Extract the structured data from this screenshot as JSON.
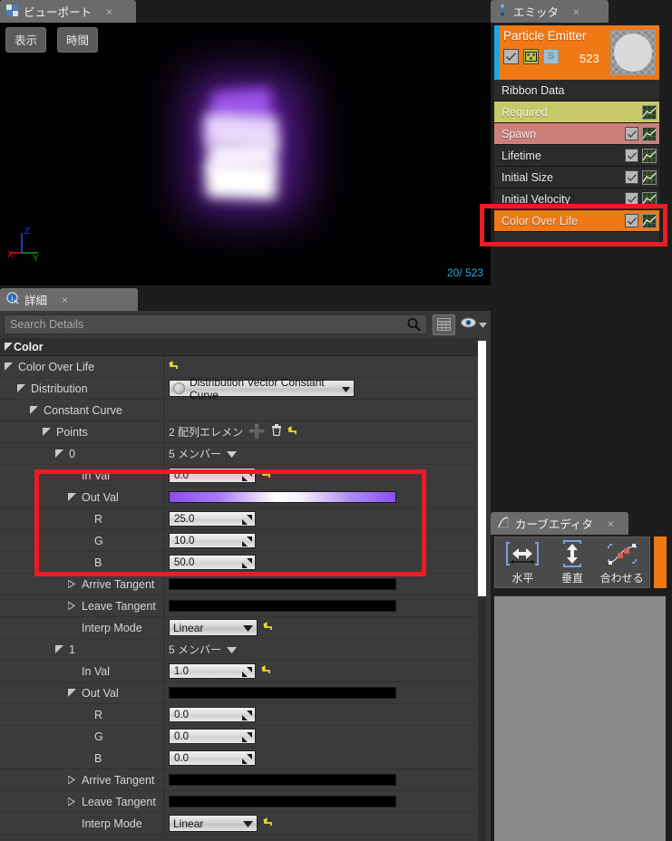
{
  "viewport": {
    "tab_title": "ビューポート",
    "tab_icon": "viewport-grid-icon",
    "close_icon": "×",
    "buttons": [
      {
        "label": "表示",
        "name": "view-menu-button"
      },
      {
        "label": "時間",
        "name": "time-menu-button"
      }
    ],
    "axis": {
      "x": "X",
      "y": "Y",
      "z": "Z"
    },
    "particle_count": "20/ 523"
  },
  "details": {
    "tab_title": "詳細",
    "tab_icon": "details-info-icon",
    "close_icon": "×",
    "search": {
      "placeholder": "Search Details",
      "value": ""
    },
    "category": "Color",
    "rows": [
      {
        "name": "color-over-life",
        "label": "Color Over Life",
        "indent": 0,
        "twisty": "down",
        "value_type": "revert"
      },
      {
        "name": "distribution",
        "label": "Distribution",
        "indent": 1,
        "twisty": "down",
        "value_type": "combo",
        "value": "Distribution Vector Constant Curve"
      },
      {
        "name": "constant-curve",
        "label": "Constant Curve",
        "indent": 2,
        "twisty": "down",
        "value_type": "none"
      },
      {
        "name": "points",
        "label": "Points",
        "indent": 3,
        "twisty": "down",
        "value_type": "array",
        "value": "2 配列エレメン"
      },
      {
        "name": "point-index-0",
        "label": "0",
        "indent": 4,
        "twisty": "down",
        "value_type": "members",
        "value": "5 メンバー"
      },
      {
        "name": "point0-in-val",
        "label": "In Val",
        "indent": 5,
        "twisty": "none",
        "value_type": "number",
        "value": "0.0",
        "revert": true
      },
      {
        "name": "point0-out-val",
        "label": "Out Val",
        "indent": 5,
        "twisty": "down",
        "value_type": "gradient"
      },
      {
        "name": "point0-r",
        "label": "R",
        "indent": 6,
        "twisty": "none",
        "value_type": "number",
        "value": "25.0"
      },
      {
        "name": "point0-g",
        "label": "G",
        "indent": 6,
        "twisty": "none",
        "value_type": "number",
        "value": "10.0"
      },
      {
        "name": "point0-b",
        "label": "B",
        "indent": 6,
        "twisty": "none",
        "value_type": "number",
        "value": "50.0"
      },
      {
        "name": "point0-arrive-tangent",
        "label": "Arrive Tangent",
        "indent": 5,
        "twisty": "right",
        "value_type": "black"
      },
      {
        "name": "point0-leave-tangent",
        "label": "Leave Tangent",
        "indent": 5,
        "twisty": "right",
        "value_type": "black"
      },
      {
        "name": "point0-interp-mode",
        "label": "Interp Mode",
        "indent": 5,
        "twisty": "none",
        "value_type": "select",
        "value": "Linear",
        "revert": true
      },
      {
        "name": "point-index-1",
        "label": "1",
        "indent": 4,
        "twisty": "down",
        "value_type": "members",
        "value": "5 メンバー"
      },
      {
        "name": "point1-in-val",
        "label": "In Val",
        "indent": 5,
        "twisty": "none",
        "value_type": "number",
        "value": "1.0",
        "revert": true
      },
      {
        "name": "point1-out-val",
        "label": "Out Val",
        "indent": 5,
        "twisty": "down",
        "value_type": "black"
      },
      {
        "name": "point1-r",
        "label": "R",
        "indent": 6,
        "twisty": "none",
        "value_type": "number",
        "value": "0.0"
      },
      {
        "name": "point1-g",
        "label": "G",
        "indent": 6,
        "twisty": "none",
        "value_type": "number",
        "value": "0.0"
      },
      {
        "name": "point1-b",
        "label": "B",
        "indent": 6,
        "twisty": "none",
        "value_type": "number",
        "value": "0.0"
      },
      {
        "name": "point1-arrive-tangent",
        "label": "Arrive Tangent",
        "indent": 5,
        "twisty": "right",
        "value_type": "black"
      },
      {
        "name": "point1-leave-tangent",
        "label": "Leave Tangent",
        "indent": 5,
        "twisty": "right",
        "value_type": "black"
      },
      {
        "name": "point1-interp-mode",
        "label": "Interp Mode",
        "indent": 5,
        "twisty": "none",
        "value_type": "select",
        "value": "Linear",
        "revert": true
      }
    ]
  },
  "emitter": {
    "tab_title": "エミッタ",
    "tab_icon": "emitter-icon",
    "close_icon": "×",
    "title": "Particle Emitter",
    "count": "523",
    "s_badge": "S",
    "section_label": "Ribbon Data",
    "modules": [
      {
        "label": "Required",
        "style": "olive",
        "checkbox": false,
        "graph": true
      },
      {
        "label": "Spawn",
        "style": "salmon",
        "checkbox": true,
        "graph": true
      },
      {
        "label": "Lifetime",
        "style": "dark",
        "checkbox": true,
        "graph": true
      },
      {
        "label": "Initial Size",
        "style": "dark",
        "checkbox": true,
        "graph": true
      },
      {
        "label": "Initial Velocity",
        "style": "dark",
        "checkbox": true,
        "graph": true
      },
      {
        "label": "Color Over Life",
        "style": "orange",
        "checkbox": true,
        "graph": true
      }
    ]
  },
  "curve_editor": {
    "tab_title": "カーブエディタ",
    "tab_icon": "curve-icon",
    "close_icon": "×",
    "buttons": [
      {
        "label": "水平",
        "name": "fit-horizontal-button"
      },
      {
        "label": "垂直",
        "name": "fit-vertical-button"
      },
      {
        "label": "合わせる",
        "name": "fit-all-button"
      }
    ]
  },
  "annotations": {
    "emitter_highlight": "Color Over Life module row highlighted",
    "properties_highlight": "In Val / Out Val / R / G / B rows highlighted",
    "color": "#ED1C24"
  }
}
